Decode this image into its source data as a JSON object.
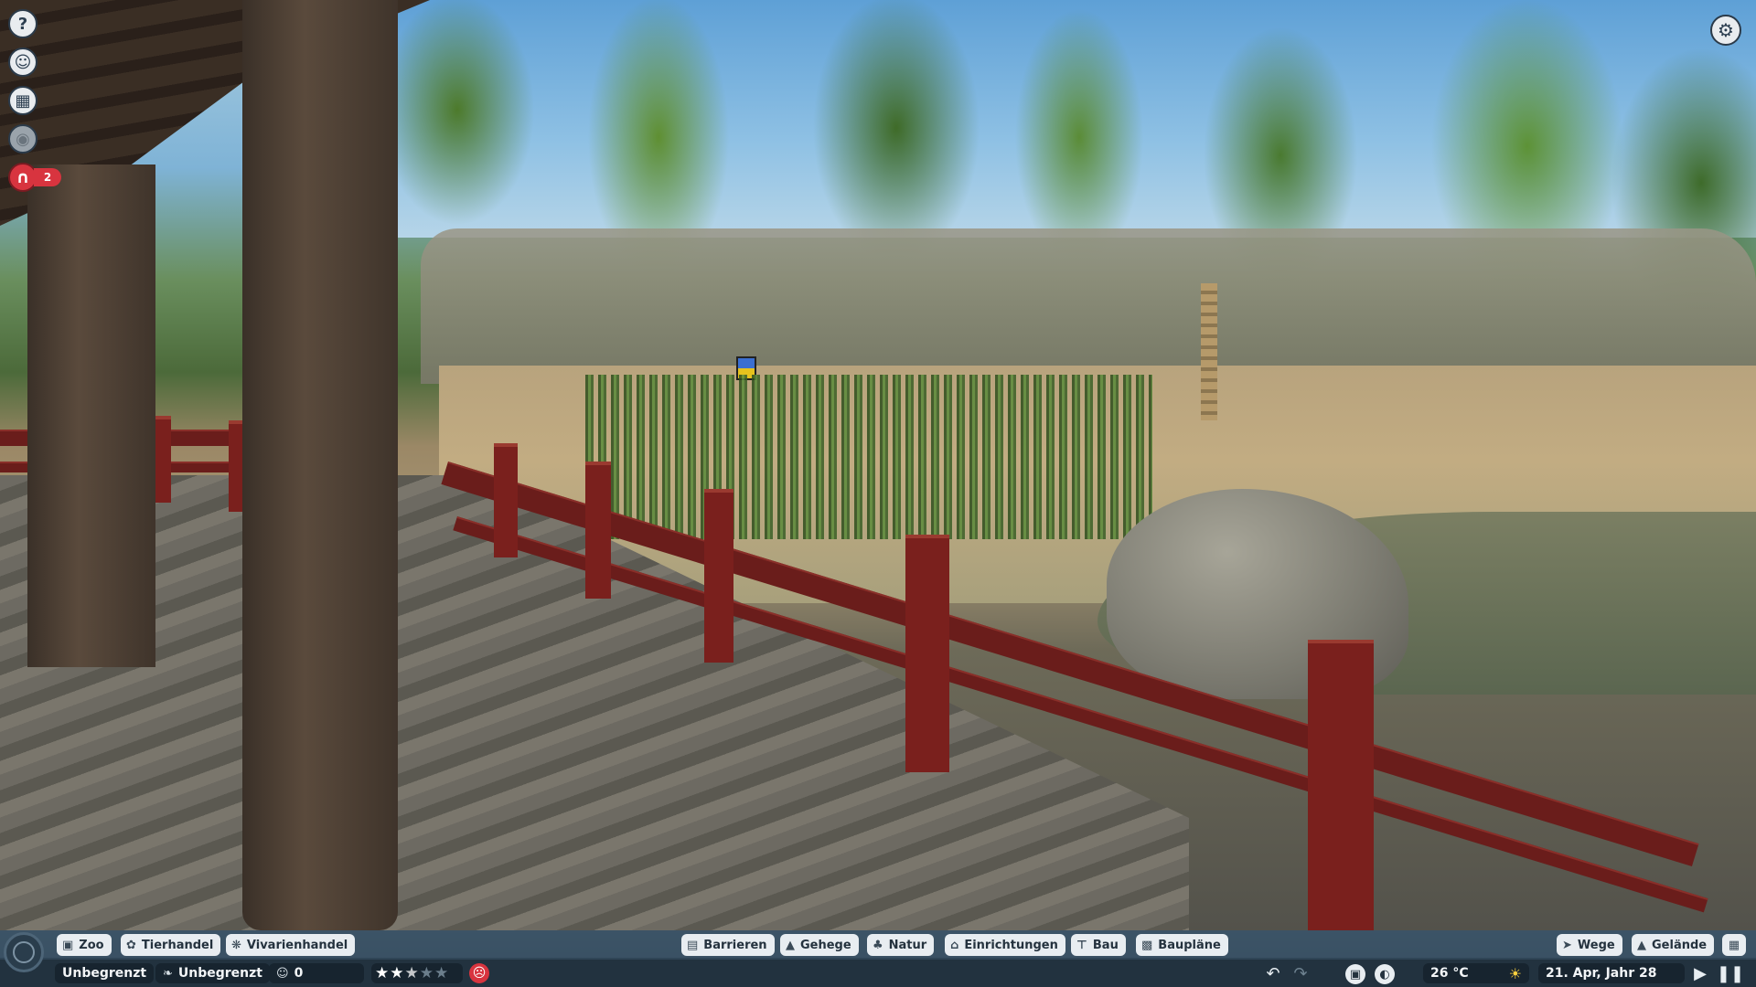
{
  "left_column": {
    "help_icon": "question-icon",
    "animal_icon": "animal-face-icon",
    "calendar_icon": "calendar-icon",
    "view_icon": "eye-icon",
    "alert_icon": "arch-alert-icon",
    "alert_count": "2"
  },
  "settings_icon": "gear-icon",
  "bottom_tabs_left": [
    {
      "label": "Zoo",
      "icon": "zoo-icon"
    },
    {
      "label": "Tierhandel",
      "icon": "paw-icon"
    },
    {
      "label": "Vivarienhandel",
      "icon": "insect-icon"
    }
  ],
  "bottom_tabs_center": [
    {
      "label": "Barrieren",
      "icon": "fence-icon"
    },
    {
      "label": "Gehege",
      "icon": "habitat-icon"
    },
    {
      "label": "Natur",
      "icon": "tree-icon"
    },
    {
      "label": "Einrichtungen",
      "icon": "building-icon"
    },
    {
      "label": "Bau",
      "icon": "construction-icon"
    },
    {
      "label": "Baupläne",
      "icon": "blueprint-icon"
    }
  ],
  "bottom_tabs_right": [
    {
      "label": "Wege",
      "icon": "path-icon"
    },
    {
      "label": "Gelände",
      "icon": "terrain-icon"
    }
  ],
  "status": {
    "money": "Unbegrenzt",
    "research": "Unbegrenzt",
    "guests": "0",
    "rating_stars": 2.5,
    "rating_max": 5,
    "mood_icon": "sad-face-icon",
    "temperature": "26 °C",
    "weather_icon": "sun-icon",
    "date": "21. Apr, Jahr 28"
  },
  "colors": {
    "bar_bg": "#2f4556",
    "tab_bg": "#e8edf1",
    "alert": "#d8343f",
    "railing": "#6a1d1b"
  }
}
